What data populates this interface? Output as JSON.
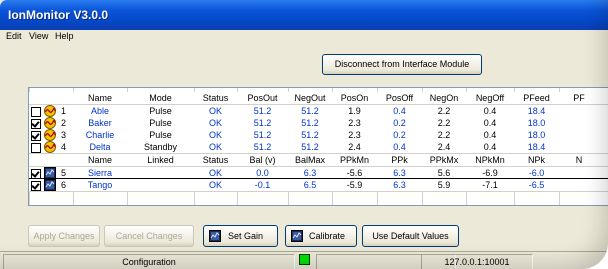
{
  "window": {
    "title": "IonMonitor V3.0.0"
  },
  "menu": {
    "items": [
      "Edit",
      "View",
      "Help"
    ]
  },
  "disconnect_label": "Disconnect from Interface Module",
  "table1": {
    "headers": [
      "Name",
      "Mode",
      "Status",
      "PosOut",
      "NegOut",
      "PosOn",
      "PosOff",
      "NegOn",
      "NegOff",
      "PFeed",
      "PF"
    ],
    "rows": [
      {
        "checked": false,
        "num": "1",
        "cells": [
          "Able",
          "Pulse",
          "OK",
          "51.2",
          "51.2",
          "1.9",
          "0.4",
          "2.2",
          "0.4",
          "18.4"
        ]
      },
      {
        "checked": true,
        "num": "2",
        "cells": [
          "Baker",
          "Pulse",
          "OK",
          "51.2",
          "51.2",
          "2.3",
          "0.2",
          "2.2",
          "0.4",
          "18.0"
        ]
      },
      {
        "checked": true,
        "num": "3",
        "cells": [
          "Charlie",
          "Pulse",
          "OK",
          "51.2",
          "51.2",
          "2.3",
          "0.2",
          "2.2",
          "0.4",
          "18.0"
        ]
      },
      {
        "checked": false,
        "num": "4",
        "cells": [
          "Delta",
          "Standby",
          "OK",
          "51.2",
          "51.2",
          "2.4",
          "0.4",
          "2.4",
          "0.4",
          "18.4"
        ]
      }
    ]
  },
  "table2": {
    "headers": [
      "Name",
      "Linked",
      "Status",
      "Bal (v)",
      "BalMax",
      "PPkMn",
      "PPk",
      "PPkMx",
      "NPkMn",
      "NPk",
      "N"
    ],
    "rows": [
      {
        "checked": true,
        "num": "5",
        "cells": [
          "Sierra",
          "",
          "OK",
          "0.0",
          "6.3",
          "-5.6",
          "6.3",
          "5.6",
          "-6.9",
          "-6.0"
        ]
      },
      {
        "checked": true,
        "num": "6",
        "cells": [
          "Tango",
          "",
          "OK",
          "-0.1",
          "6.5",
          "-5.9",
          "6.3",
          "5.9",
          "-7.1",
          "-6.5"
        ]
      }
    ]
  },
  "buttons": {
    "apply": "Apply Changes",
    "cancel": "Cancel Changes",
    "set_gain": "Set Gain",
    "calibrate": "Calibrate",
    "default": "Use Default Values"
  },
  "statusbar": {
    "mode": "Configuration",
    "address": "127.0.0.1:10001"
  },
  "colors": {
    "title_blue": "#0a54d8",
    "value_blue": "#0033cc",
    "status_led": "#00e000"
  }
}
